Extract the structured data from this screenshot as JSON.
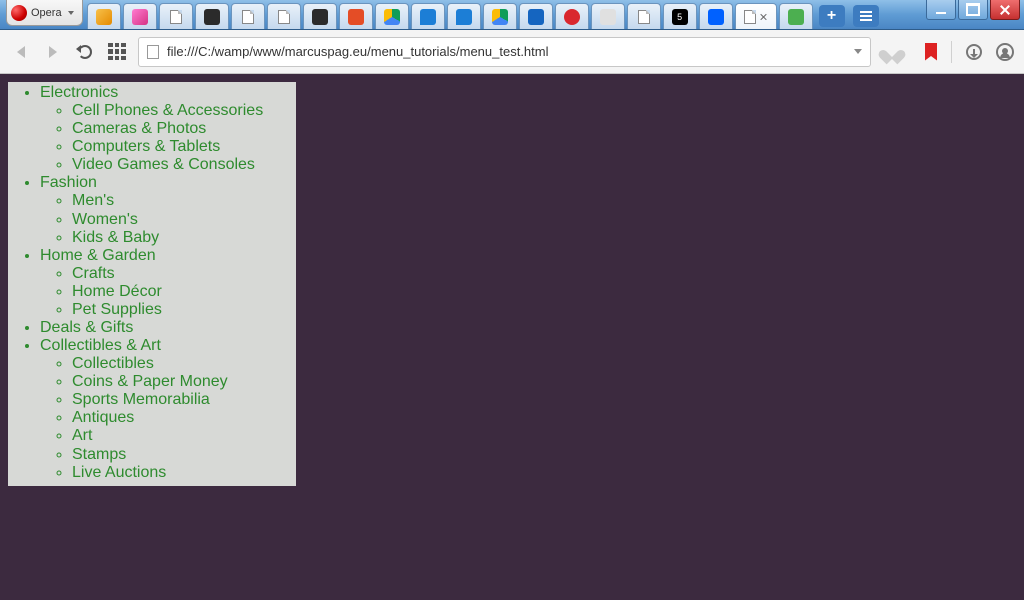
{
  "browser": {
    "name": "Opera",
    "url": "file:///C:/wamp/www/marcuspag.eu/menu_tutorials/menu_test.html"
  },
  "menu": {
    "items": [
      {
        "label": "Electronics",
        "children": [
          {
            "label": "Cell Phones & Accessories"
          },
          {
            "label": "Cameras & Photos"
          },
          {
            "label": "Computers & Tablets"
          },
          {
            "label": "Video Games & Consoles"
          }
        ]
      },
      {
        "label": "Fashion",
        "children": [
          {
            "label": "Men's"
          },
          {
            "label": "Women's"
          },
          {
            "label": "Kids & Baby"
          }
        ]
      },
      {
        "label": "Home & Garden",
        "children": [
          {
            "label": "Crafts"
          },
          {
            "label": "Home Décor"
          },
          {
            "label": "Pet Supplies"
          }
        ]
      },
      {
        "label": "Deals & Gifts",
        "children": []
      },
      {
        "label": "Collectibles & Art",
        "children": [
          {
            "label": "Collectibles"
          },
          {
            "label": "Coins & Paper Money"
          },
          {
            "label": "Sports Memorabilia"
          },
          {
            "label": "Antiques"
          },
          {
            "label": "Art"
          },
          {
            "label": "Stamps"
          },
          {
            "label": "Live Auctions"
          }
        ]
      }
    ]
  }
}
